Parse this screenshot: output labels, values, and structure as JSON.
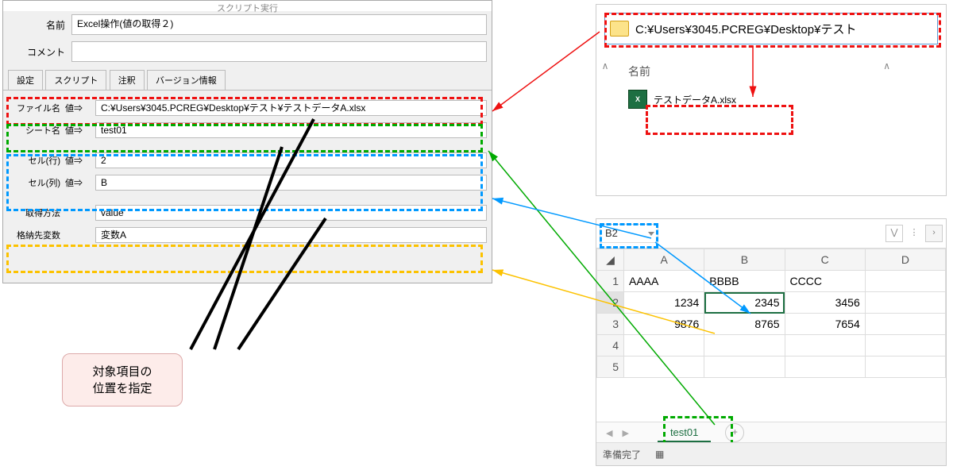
{
  "dialog": {
    "header": "スクリプト実行",
    "name_label": "名前",
    "name_value": "Excel操作(値の取得２)",
    "comment_label": "コメント",
    "comment_value": "",
    "tabs": [
      "設定",
      "スクリプト",
      "注釈",
      "バージョン情報"
    ],
    "val_marker": "値⇒",
    "params": {
      "file_label": "ファイル名",
      "file_value": "C:¥Users¥3045.PCREG¥Desktop¥テスト¥テストデータA.xlsx",
      "sheet_label": "シート名",
      "sheet_value": "test01",
      "row_label": "セル(行)",
      "row_value": "2",
      "col_label": "セル(列)",
      "col_value": "B",
      "method_label": "取得方法",
      "method_value": "value",
      "var_label": "格納先変数",
      "var_value": "変数A"
    }
  },
  "explorer": {
    "path": "C:¥Users¥3045.PCREG¥Desktop¥テスト",
    "header": "名前",
    "file": "テストデータA.xlsx",
    "scroll_up": "∧",
    "caret": "∧"
  },
  "excel": {
    "namebox": "B2",
    "cols": [
      "A",
      "B",
      "C",
      "D"
    ],
    "rows": [
      {
        "n": "1",
        "cells": [
          "AAAA",
          "BBBB",
          "CCCC",
          ""
        ],
        "lft": true
      },
      {
        "n": "2",
        "cells": [
          "1234",
          "2345",
          "3456",
          ""
        ]
      },
      {
        "n": "3",
        "cells": [
          "9876",
          "8765",
          "7654",
          ""
        ]
      },
      {
        "n": "4",
        "cells": [
          "",
          "",
          "",
          ""
        ]
      },
      {
        "n": "5",
        "cells": [
          "",
          "",
          "",
          ""
        ]
      }
    ],
    "sheet_tab": "test01",
    "nav_prev": "◀",
    "nav_next": "▶",
    "plus": "+",
    "expand": "⋁",
    "status": "準備完了",
    "rec_icon": "▦"
  },
  "callout": {
    "l1": "対象項目の",
    "l2": "位置を指定"
  }
}
